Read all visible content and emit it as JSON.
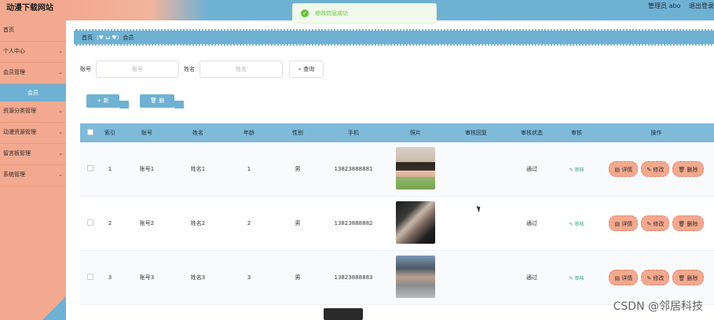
{
  "app": {
    "title": "动漫下载网站"
  },
  "header": {
    "user_label": "管理员 abo",
    "logout": "退出登录"
  },
  "toast": {
    "message": "修改信息成功"
  },
  "sidebar": {
    "items": [
      {
        "label": "首页",
        "has_children": false
      },
      {
        "label": "个人中心",
        "has_children": true
      },
      {
        "label": "会员管理",
        "has_children": true
      },
      {
        "label": "资源分类管理",
        "has_children": true
      },
      {
        "label": "动漫资源管理",
        "has_children": true
      },
      {
        "label": "留言板管理",
        "has_children": true
      },
      {
        "label": "系统管理",
        "has_children": true
      }
    ],
    "active_sub": "会员",
    "chevron_down": "⌄"
  },
  "breadcrumb": {
    "home": "首页",
    "separator": "(♥ ω ♥)",
    "current": "会员"
  },
  "search": {
    "account_label": "账号",
    "account_placeholder": "账号",
    "name_label": "姓名",
    "name_placeholder": "姓名",
    "query_button": "查询",
    "query_icon": "⌕"
  },
  "actions": {
    "add": "新增",
    "add_icon": "+",
    "delete": "删除",
    "delete_icon": "🗑"
  },
  "table": {
    "headers": [
      "索引",
      "账号",
      "姓名",
      "年龄",
      "性别",
      "手机",
      "照片",
      "审核回复",
      "审核状态",
      "审核",
      "操作"
    ],
    "rows": [
      {
        "index": "1",
        "account": "账号1",
        "name": "姓名1",
        "age": "1",
        "sex": "男",
        "phone": "13823888881",
        "reply": "",
        "status": "通过",
        "review": "审核"
      },
      {
        "index": "2",
        "account": "账号2",
        "name": "姓名2",
        "age": "2",
        "sex": "男",
        "phone": "13823888882",
        "reply": "",
        "status": "通过",
        "review": "审核"
      },
      {
        "index": "3",
        "account": "账号3",
        "name": "姓名3",
        "age": "3",
        "sex": "男",
        "phone": "13823888883",
        "reply": "",
        "status": "通过",
        "review": "审核"
      }
    ],
    "ops": {
      "detail": "详情",
      "edit": "修改",
      "delete": "删除"
    }
  },
  "watermark": "CSDN @邻居科技",
  "colors": {
    "accent_blue": "#6fb1d3",
    "accent_salmon": "#f2a98f",
    "success_green": "#67c23a"
  }
}
